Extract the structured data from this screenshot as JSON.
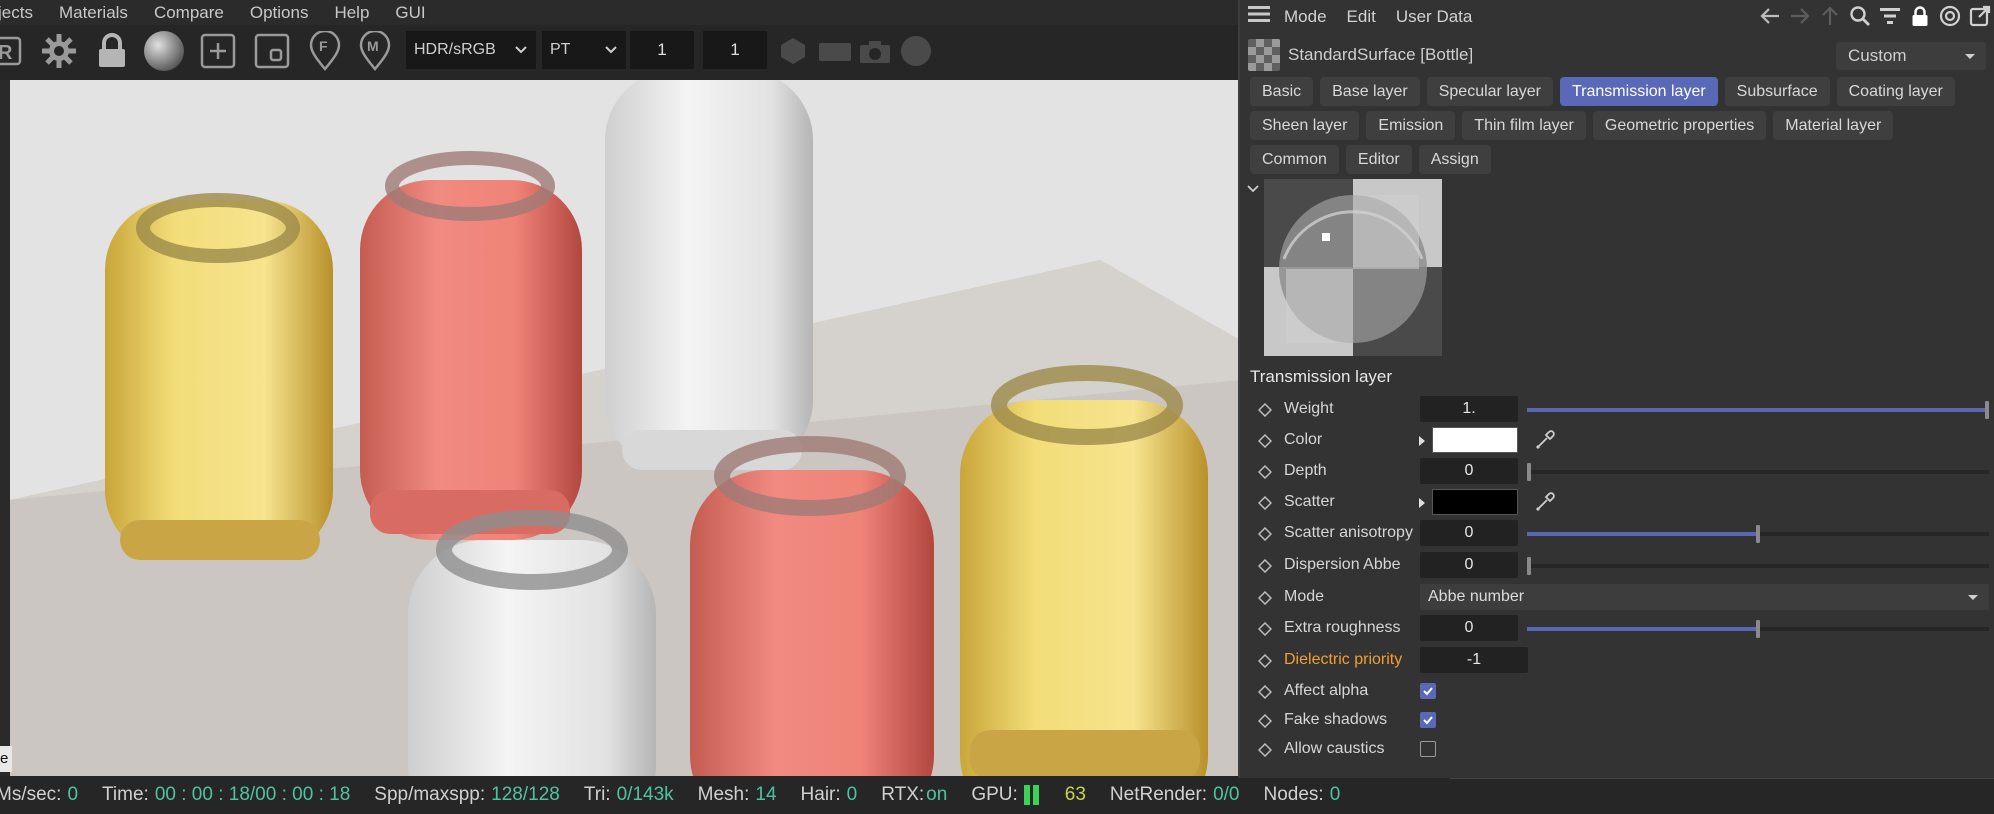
{
  "viewer": {
    "menu": [
      "jects",
      "Materials",
      "Compare",
      "Options",
      "Help",
      "GUI"
    ],
    "toolbar": {
      "color_space": "HDR/sRGB",
      "kernel": "PT",
      "value_1": "1",
      "value_2": "1"
    },
    "status": {
      "ms_label": "Ms/sec:",
      "ms_value": "0",
      "time_label": "Time:",
      "time_value": "00 : 00 : 18/00 : 00 : 18",
      "spp_label": "Spp/maxspp:",
      "spp_value": "128/128",
      "tri_label": "Tri:",
      "tri_value": "0/143k",
      "mesh_label": "Mesh:",
      "mesh_value": "14",
      "hair_label": "Hair:",
      "hair_value": "0",
      "rtx_label": "RTX:",
      "rtx_value": "on",
      "gpu_label": "GPU:",
      "gpu_value": "63",
      "net_label": "NetRender:",
      "net_value": "0/0",
      "nodes_label": "Nodes:",
      "nodes_value": "0"
    },
    "tiny_tab": "e"
  },
  "panel": {
    "menu": [
      "Mode",
      "Edit",
      "User Data"
    ],
    "material_name": "StandardSurface [Bottle]",
    "preset": "Custom",
    "tabs_row1": [
      "Basic",
      "Base layer",
      "Specular layer",
      "Transmission layer",
      "Subsurface",
      "Coating layer"
    ],
    "tabs_row2": [
      "Sheen layer",
      "Emission",
      "Thin film layer",
      "Geometric properties",
      "Material layer"
    ],
    "tabs_row3": [
      "Common",
      "Editor",
      "Assign"
    ],
    "active_tab": "Transmission layer",
    "section_title": "Transmission layer",
    "params": {
      "weight": {
        "label": "Weight",
        "value": "1.",
        "level": 1.0
      },
      "color": {
        "label": "Color",
        "swatch": "#ffffff"
      },
      "depth": {
        "label": "Depth",
        "value": "0",
        "level": 0.0
      },
      "scatter": {
        "label": "Scatter",
        "swatch": "#000000"
      },
      "scatter_anisotropy": {
        "label": "Scatter anisotropy",
        "value": "0",
        "level": 0.5
      },
      "dispersion_abbe": {
        "label": "Dispersion Abbe",
        "value": "0",
        "level": 0.0
      },
      "mode": {
        "label": "Mode",
        "value": "Abbe number"
      },
      "extra_roughness": {
        "label": "Extra roughness",
        "value": "0",
        "level": 0.5
      },
      "dielectric_priority": {
        "label": "Dielectric priority",
        "value": "-1"
      },
      "affect_alpha": {
        "label": "Affect alpha",
        "checked": true
      },
      "fake_shadows": {
        "label": "Fake shadows",
        "checked": true
      },
      "allow_caustics": {
        "label": "Allow caustics",
        "checked": false
      }
    }
  },
  "colors": {
    "accent": "#5a68b8",
    "status_value": "#4fc3a1",
    "warning": "#f0a030"
  }
}
